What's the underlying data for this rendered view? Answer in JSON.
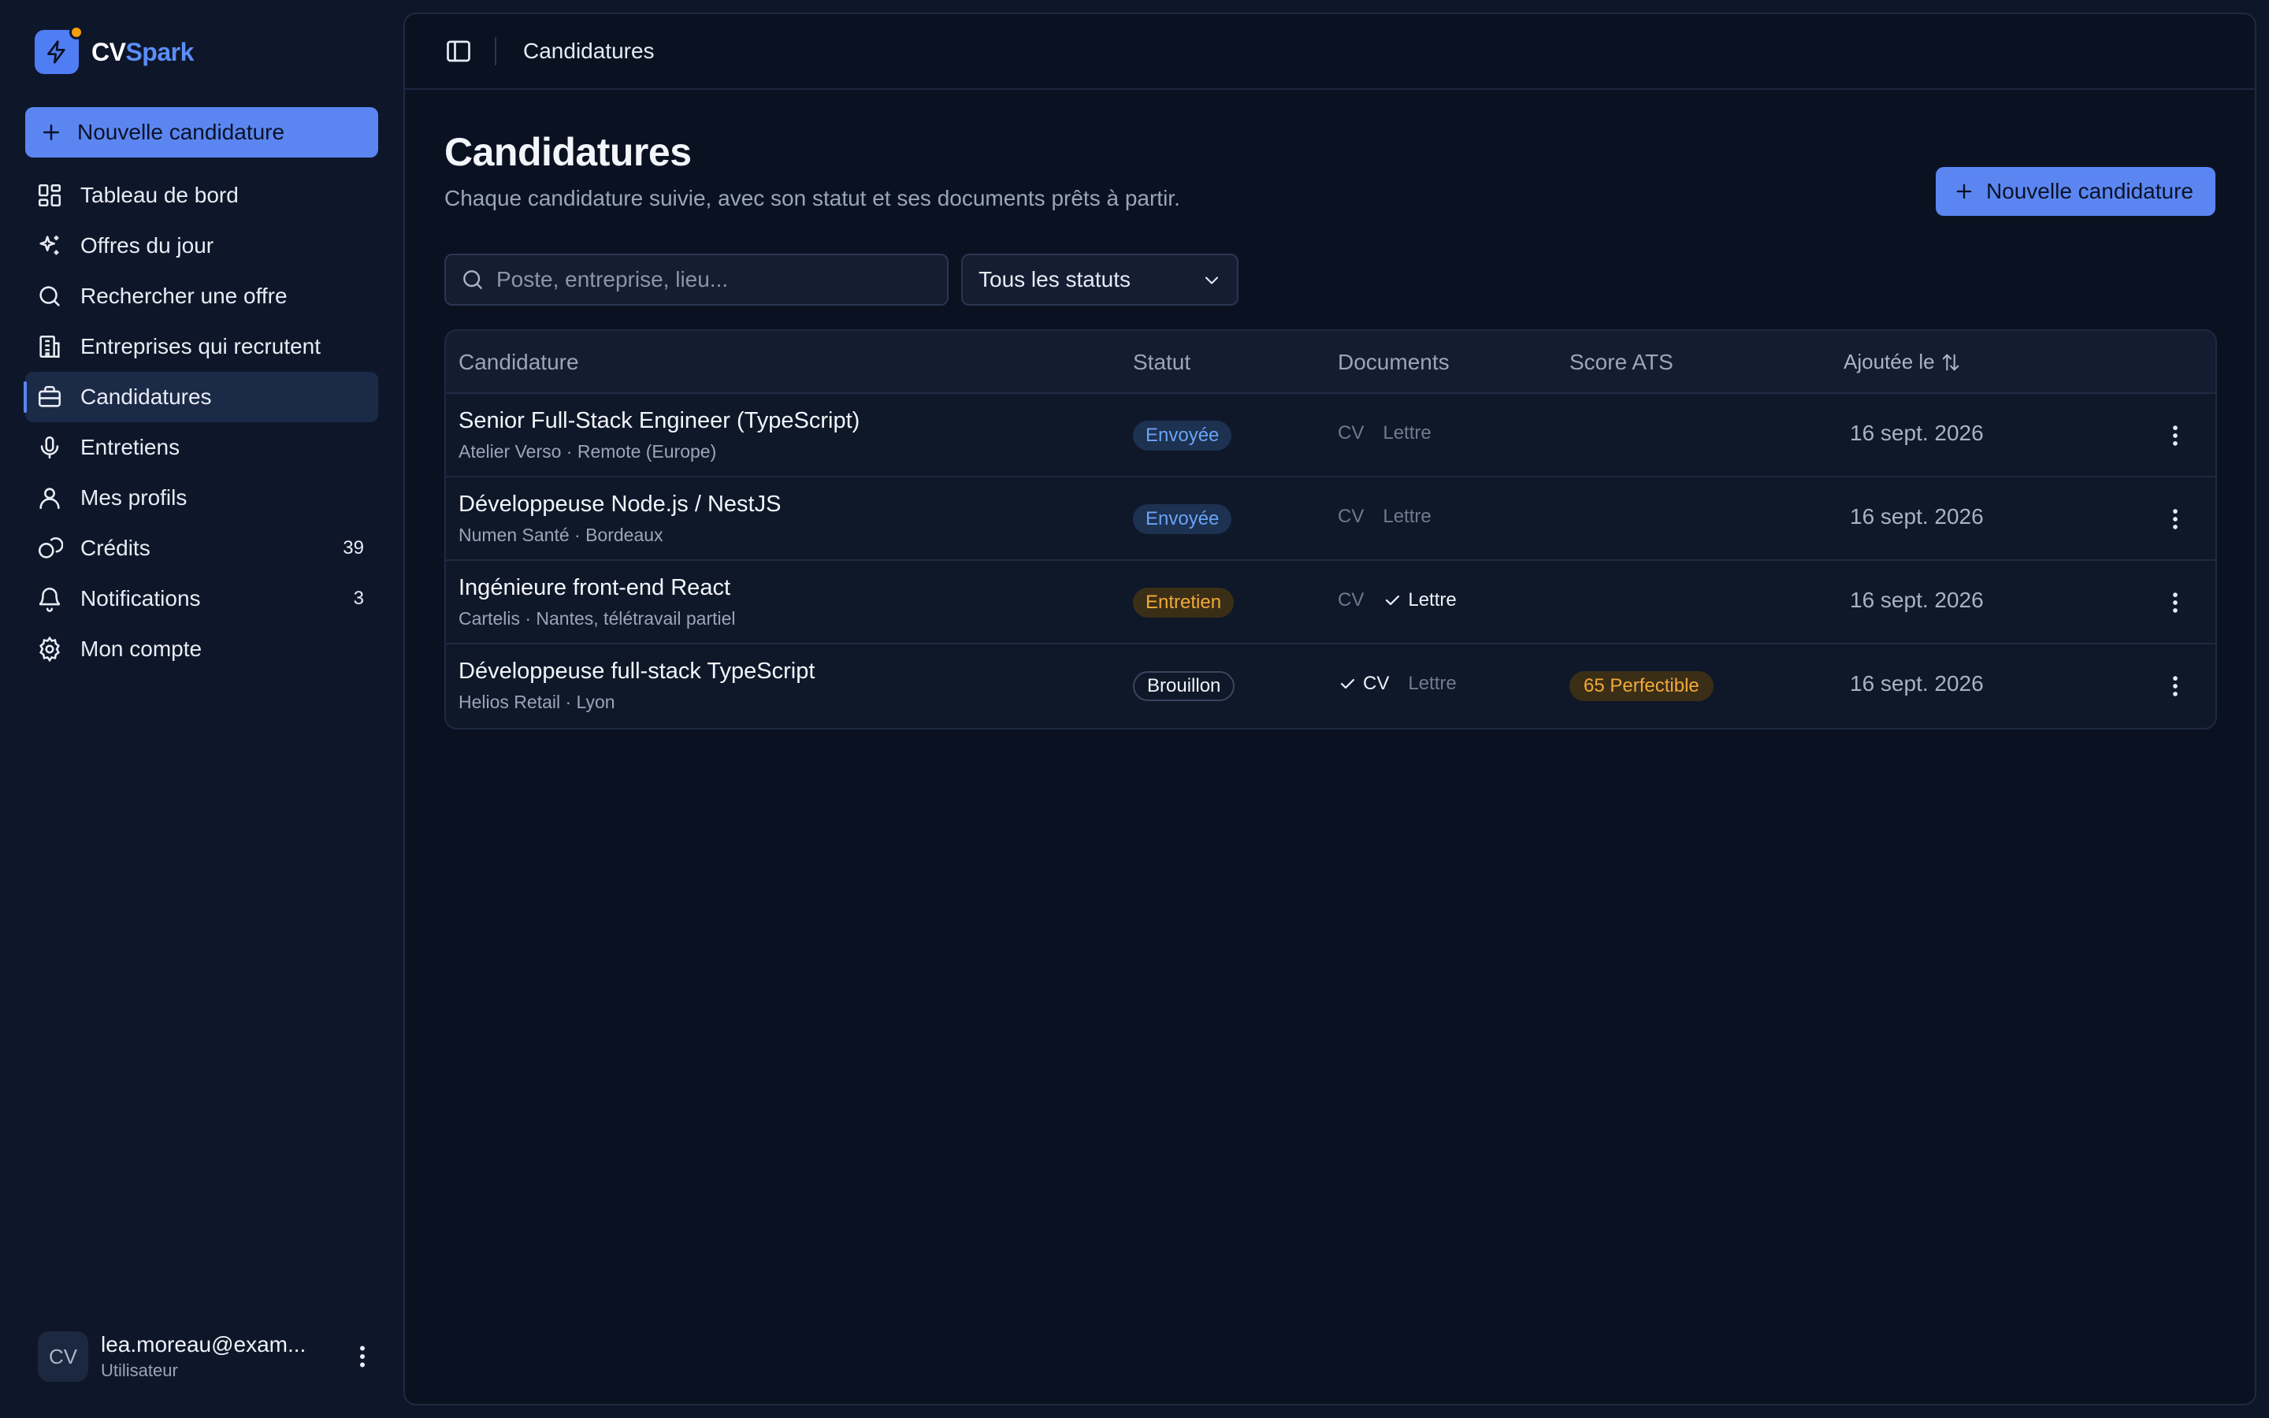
{
  "app": {
    "brand_cv": "CV",
    "brand_spark": "Spark"
  },
  "sidebar": {
    "new_button": "Nouvelle candidature",
    "items": [
      {
        "label": "Tableau de bord",
        "icon": "dashboard-icon"
      },
      {
        "label": "Offres du jour",
        "icon": "sparkles-icon"
      },
      {
        "label": "Rechercher une offre",
        "icon": "search-icon"
      },
      {
        "label": "Entreprises qui recrutent",
        "icon": "building-icon"
      },
      {
        "label": "Candidatures",
        "icon": "briefcase-icon",
        "active": true
      },
      {
        "label": "Entretiens",
        "icon": "microphone-icon"
      },
      {
        "label": "Mes profils",
        "icon": "user-icon"
      },
      {
        "label": "Crédits",
        "icon": "coins-icon",
        "count": "39"
      },
      {
        "label": "Notifications",
        "icon": "bell-icon",
        "count": "3"
      },
      {
        "label": "Mon compte",
        "icon": "gear-icon"
      }
    ],
    "user": {
      "initials": "CV",
      "email": "lea.moreau@exam...",
      "role": "Utilisateur"
    }
  },
  "topbar": {
    "title": "Candidatures"
  },
  "main": {
    "title": "Candidatures",
    "subtitle": "Chaque candidature suivie, avec son statut et ses documents prêts à partir.",
    "new_button": "Nouvelle candidature",
    "search_placeholder": "Poste, entreprise, lieu...",
    "status_filter": "Tous les statuts"
  },
  "table": {
    "headers": {
      "application": "Candidature",
      "status": "Statut",
      "documents": "Documents",
      "ats": "Score ATS",
      "added": "Ajoutée le"
    },
    "rows": [
      {
        "title": "Senior Full-Stack Engineer (TypeScript)",
        "subtitle": "Atelier Verso · Remote (Europe)",
        "status": "Envoyée",
        "status_kind": "sent",
        "cv": "CV",
        "cv_done": false,
        "letter": "Lettre",
        "letter_done": false,
        "ats": "",
        "date": "16 sept. 2026"
      },
      {
        "title": "Développeuse Node.js / NestJS",
        "subtitle": "Numen Santé · Bordeaux",
        "status": "Envoyée",
        "status_kind": "sent",
        "cv": "CV",
        "cv_done": false,
        "letter": "Lettre",
        "letter_done": false,
        "ats": "",
        "date": "16 sept. 2026"
      },
      {
        "title": "Ingénieure front-end React",
        "subtitle": "Cartelis · Nantes, télétravail partiel",
        "status": "Entretien",
        "status_kind": "interview",
        "cv": "CV",
        "cv_done": false,
        "letter": "Lettre",
        "letter_done": true,
        "ats": "",
        "date": "16 sept. 2026"
      },
      {
        "title": "Développeuse full-stack TypeScript",
        "subtitle": "Helios Retail · Lyon",
        "status": "Brouillon",
        "status_kind": "draft",
        "cv": "CV",
        "cv_done": true,
        "letter": "Lettre",
        "letter_done": false,
        "ats": "65 Perfectible",
        "date": "16 sept. 2026"
      }
    ]
  },
  "colors": {
    "accent": "#5b86f2",
    "background": "#0e1629",
    "sent": "#6aa3f5",
    "warning": "#f0a93a"
  }
}
